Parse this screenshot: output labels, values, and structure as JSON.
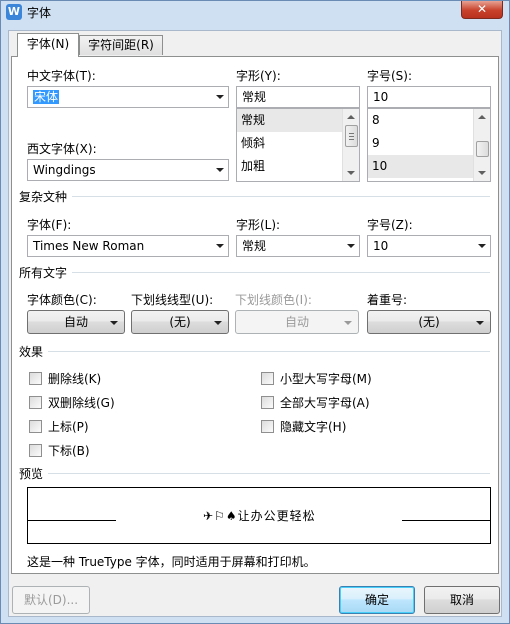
{
  "window": {
    "title": "字体",
    "app_icon": "W",
    "close_symbol": "✕"
  },
  "tabs": [
    {
      "label": "字体(N)",
      "active": true
    },
    {
      "label": "字符间距(R)",
      "active": false
    }
  ],
  "chinese_font": {
    "label": "中文字体(T):",
    "value": "宋体"
  },
  "style": {
    "label": "字形(Y):",
    "value": "常规",
    "options": [
      "常规",
      "倾斜",
      "加粗"
    ],
    "selected_index": 0
  },
  "size": {
    "label": "字号(S):",
    "value": "10",
    "options": [
      "8",
      "9",
      "10"
    ],
    "selected_index": 2
  },
  "western_font": {
    "label": "西文字体(X):",
    "value": "Wingdings"
  },
  "complex_script": {
    "section_title": "复杂文种",
    "font_label": "字体(F):",
    "font_value": "Times New Roman",
    "style_label": "字形(L):",
    "style_value": "常规",
    "size_label": "字号(Z):",
    "size_value": "10"
  },
  "all_text": {
    "section_title": "所有文字",
    "font_color_label": "字体颜色(C):",
    "font_color_value": "自动",
    "underline_style_label": "下划线线型(U):",
    "underline_style_value": "(无)",
    "underline_color_label": "下划线颜色(I):",
    "underline_color_value": "自动",
    "emphasis_label": "着重号:",
    "emphasis_value": "(无)"
  },
  "effects": {
    "section_title": "效果",
    "left": [
      "删除线(K)",
      "双删除线(G)",
      "上标(P)",
      "下标(B)"
    ],
    "right": [
      "小型大写字母(M)",
      "全部大写字母(A)",
      "隐藏文字(H)"
    ]
  },
  "preview": {
    "section_title": "预览",
    "sample_symbols": "✈⚐♠",
    "sample_text": "让办公更轻松",
    "description": "这是一种 TrueType 字体，同时适用于屏幕和打印机。"
  },
  "buttons": {
    "default": "默认(D)...",
    "ok": "确定",
    "cancel": "取消"
  },
  "colors": {
    "title_bar": "#cfe0f2",
    "selection": "#3399ff",
    "close": "#c8412b"
  }
}
